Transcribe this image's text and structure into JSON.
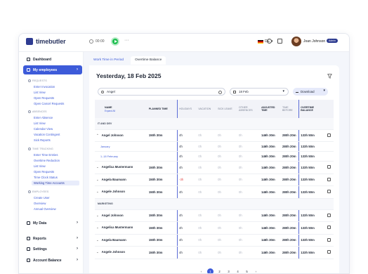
{
  "brand": {
    "name": "timebutler"
  },
  "topbar": {
    "timer": "00:00",
    "more": "···",
    "language": "DE",
    "user_name": "Joan Johnson",
    "user_badge": "Admin"
  },
  "sidebar": {
    "dashboard": "Dashboard",
    "my_employees": "My employees",
    "sections": [
      {
        "title": "Requests",
        "links": [
          "Enter Invocation",
          "List View",
          "Open Requests",
          "Open Cancel Requests"
        ]
      },
      {
        "title": "Absences",
        "links": [
          "Enter Absence",
          "List View",
          "Calendar View",
          "Vacation Contingent",
          "Sick Reports"
        ]
      },
      {
        "title": "Time Tracking",
        "links": [
          "Enter Time Entries",
          "Overtime Reduction",
          "List View",
          "Open Requests",
          "Time Clock Status",
          "Working Time Accounts"
        ]
      },
      {
        "title": "Employees",
        "links": [
          "Create User",
          "Overview",
          "Annual Overview"
        ]
      }
    ],
    "my_data": "My Data",
    "reports": "Reports",
    "settings": "Settings",
    "account_balance": "Account Balance"
  },
  "tabs": [
    "Work Time in Period",
    "Overtime Balance"
  ],
  "card": {
    "date_title": "Yesterday, 18 Feb 2025",
    "search_value": "Angel",
    "date_select": "18 Feb",
    "download_label": "Download"
  },
  "table": {
    "headers": {
      "name": "NAME",
      "name_sub": "Expand All",
      "planned": "PLANNED TIME",
      "holidays": "HOLIDAYS",
      "vacation": "VACATION",
      "sick": "SICK LEAVE",
      "other": "OTHER ABSENCES",
      "adjusted": "ADJUSTED TIME",
      "time_before": "TIME BEFORE",
      "overtime": "OVERTIME BALANCE"
    },
    "groups": [
      {
        "name": "IT AND DEV",
        "rows": [
          {
            "name": "Angel Johnson",
            "expanded": true,
            "planned": "150h 30m",
            "holidays": "4h",
            "vacation": "0h",
            "sick": "0h",
            "other": "0h",
            "adjusted": "146h 30m",
            "before": "280h 20m",
            "overtime": "133h 50m",
            "subrows": [
              {
                "label": "January",
                "holidays": "4h",
                "vacation": "0h",
                "sick": "0h",
                "other": "0h",
                "adjusted": "146h 30m",
                "before": "280h 20m",
                "overtime": "133h 50m"
              },
              {
                "label": "1.-18 February",
                "holidays": "4h",
                "vacation": "0h",
                "sick": "0h",
                "other": "0h",
                "adjusted": "146h 30m",
                "before": "280h 20m",
                "overtime": "133h 50m"
              }
            ]
          },
          {
            "name": "Angelica Mustermann",
            "expanded": false,
            "planned": "150h 30m",
            "holidays": "4h",
            "vacation": "0h",
            "sick": "0h",
            "other": "0h",
            "adjusted": "146h 30m",
            "before": "280h 20m",
            "overtime": "133h 50m"
          },
          {
            "name": "Angela Baumann",
            "expanded": false,
            "planned": "150h 30m",
            "holidays": "-3h",
            "vacation": "0h",
            "sick": "0h",
            "other": "0h",
            "adjusted": "146h 30m",
            "before": "280h 20m",
            "overtime": "133h 50m"
          },
          {
            "name": "Angele Johnson",
            "expanded": false,
            "planned": "150h 30m",
            "holidays": "4h",
            "vacation": "0h",
            "sick": "0h",
            "other": "0h",
            "adjusted": "146h 30m",
            "before": "280h 20m",
            "overtime": "133h 50m"
          }
        ]
      },
      {
        "name": "MARKETING",
        "rows": [
          {
            "name": "Angel Johnson",
            "planned": "150h 30m",
            "holidays": "4h",
            "vacation": "0h",
            "sick": "0h",
            "other": "0h",
            "adjusted": "146h 30m",
            "before": "280h 20m",
            "overtime": "133h 50m"
          },
          {
            "name": "Angelica Mustermann",
            "planned": "150h 30m",
            "holidays": "4h",
            "vacation": "0h",
            "sick": "0h",
            "other": "0h",
            "adjusted": "146h 30m",
            "before": "280h 20m",
            "overtime": "133h 50m"
          },
          {
            "name": "Angela Baumann",
            "planned": "150h 30m",
            "holidays": "4h",
            "vacation": "0h",
            "sick": "0h",
            "other": "0h",
            "adjusted": "146h 30m",
            "before": "280h 20m",
            "overtime": "133h 50m"
          },
          {
            "name": "Angele Johnson",
            "planned": "150h 30m",
            "holidays": "4h",
            "vacation": "0h",
            "sick": "0h",
            "other": "0h",
            "adjusted": "146h 30m",
            "before": "280h 20m",
            "overtime": "133h 50m"
          }
        ]
      }
    ]
  },
  "pagination": {
    "prev": "‹",
    "pages": [
      "1",
      "2",
      "3",
      "4",
      "5"
    ],
    "current": "1",
    "next": "›"
  },
  "colors": {
    "accent": "#3d5bd9",
    "brand_dark": "#2f3c92",
    "play_green": "#1fbf51",
    "negative": "#e34a4a"
  }
}
